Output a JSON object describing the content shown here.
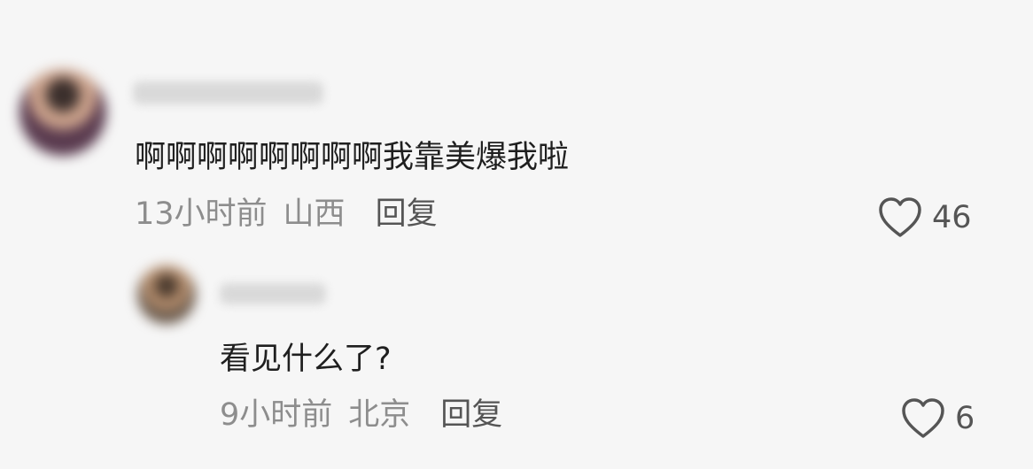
{
  "comments": [
    {
      "text": "啊啊啊啊啊啊啊啊我靠美爆我啦",
      "time": "13小时前",
      "location": "山西",
      "reply_label": "回复",
      "likes": "46"
    },
    {
      "text": "看见什么了?",
      "time": "9小时前",
      "location": "北京",
      "reply_label": "回复",
      "likes": "6"
    }
  ],
  "icons": {
    "like": "heart-outline-icon"
  },
  "colors": {
    "background": "#f6f6f6",
    "primary_text": "#1f1f1f",
    "secondary_text": "#8d8d8d",
    "action_text": "#555555"
  }
}
